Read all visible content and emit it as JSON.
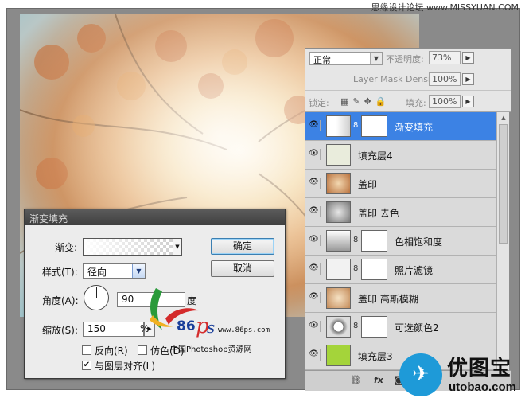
{
  "watermark_top": "思缘设计论坛 www.MISSYUAN.COM",
  "layers_panel": {
    "blend_mode": "正常",
    "opacity_label": "不透明度:",
    "opacity_value": "73%",
    "mask_density_label": "Layer Mask Density",
    "mask_density_value": "100%",
    "lock_label": "锁定:",
    "fill_label": "填充:",
    "fill_value": "100%",
    "layers": [
      {
        "name": "渐变填充",
        "selected": true
      },
      {
        "name": "填充层4"
      },
      {
        "name": "盖印"
      },
      {
        "name": "盖印 去色"
      },
      {
        "name": "色相饱和度"
      },
      {
        "name": "照片滤镜"
      },
      {
        "name": "盖印 高斯模糊"
      },
      {
        "name": "可选颜色2"
      },
      {
        "name": "填充层3"
      }
    ],
    "footer_fx": "fx"
  },
  "dialog": {
    "title": "渐变填充",
    "gradient_label": "渐变:",
    "style_label": "样式(T):",
    "style_value": "径向",
    "angle_label": "角度(A):",
    "angle_value": "90",
    "angle_unit": "度",
    "scale_label": "缩放(S):",
    "scale_value": "150",
    "scale_unit": "%",
    "reverse_label": "反向(R)",
    "dither_label": "仿色(D)",
    "align_label": "与图层对齐(L)",
    "align_checked": true,
    "ok_label": "确定",
    "cancel_label": "取消"
  },
  "watermark_86": {
    "brand": "86",
    "site": "www.86ps.com",
    "tagline": "中国Photoshop资源网"
  },
  "watermark_utobao": {
    "cn": "优图宝",
    "en": "utobao.com"
  }
}
